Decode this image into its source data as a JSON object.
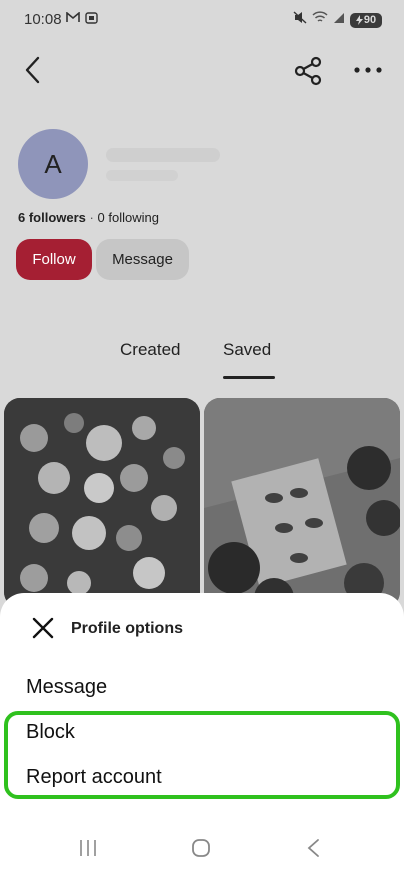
{
  "status_bar": {
    "time": "10:08",
    "battery": "90"
  },
  "profile": {
    "avatar_initial": "A",
    "followers": "6 followers",
    "separator": "·",
    "following": "0 following",
    "follow_label": "Follow",
    "message_label": "Message"
  },
  "tabs": [
    {
      "label": "Created"
    },
    {
      "label": "Saved"
    }
  ],
  "sheet": {
    "title": "Profile options",
    "options": [
      {
        "label": "Message"
      },
      {
        "label": "Block"
      },
      {
        "label": "Report account"
      }
    ]
  },
  "colors": {
    "follow_button": "#a51f33",
    "avatar": "#8f95ba",
    "highlight": "#2fc11e"
  },
  "icons": {
    "back": "chevron-left-icon",
    "share": "share-icon",
    "more": "more-horizontal-icon",
    "close": "close-icon"
  }
}
